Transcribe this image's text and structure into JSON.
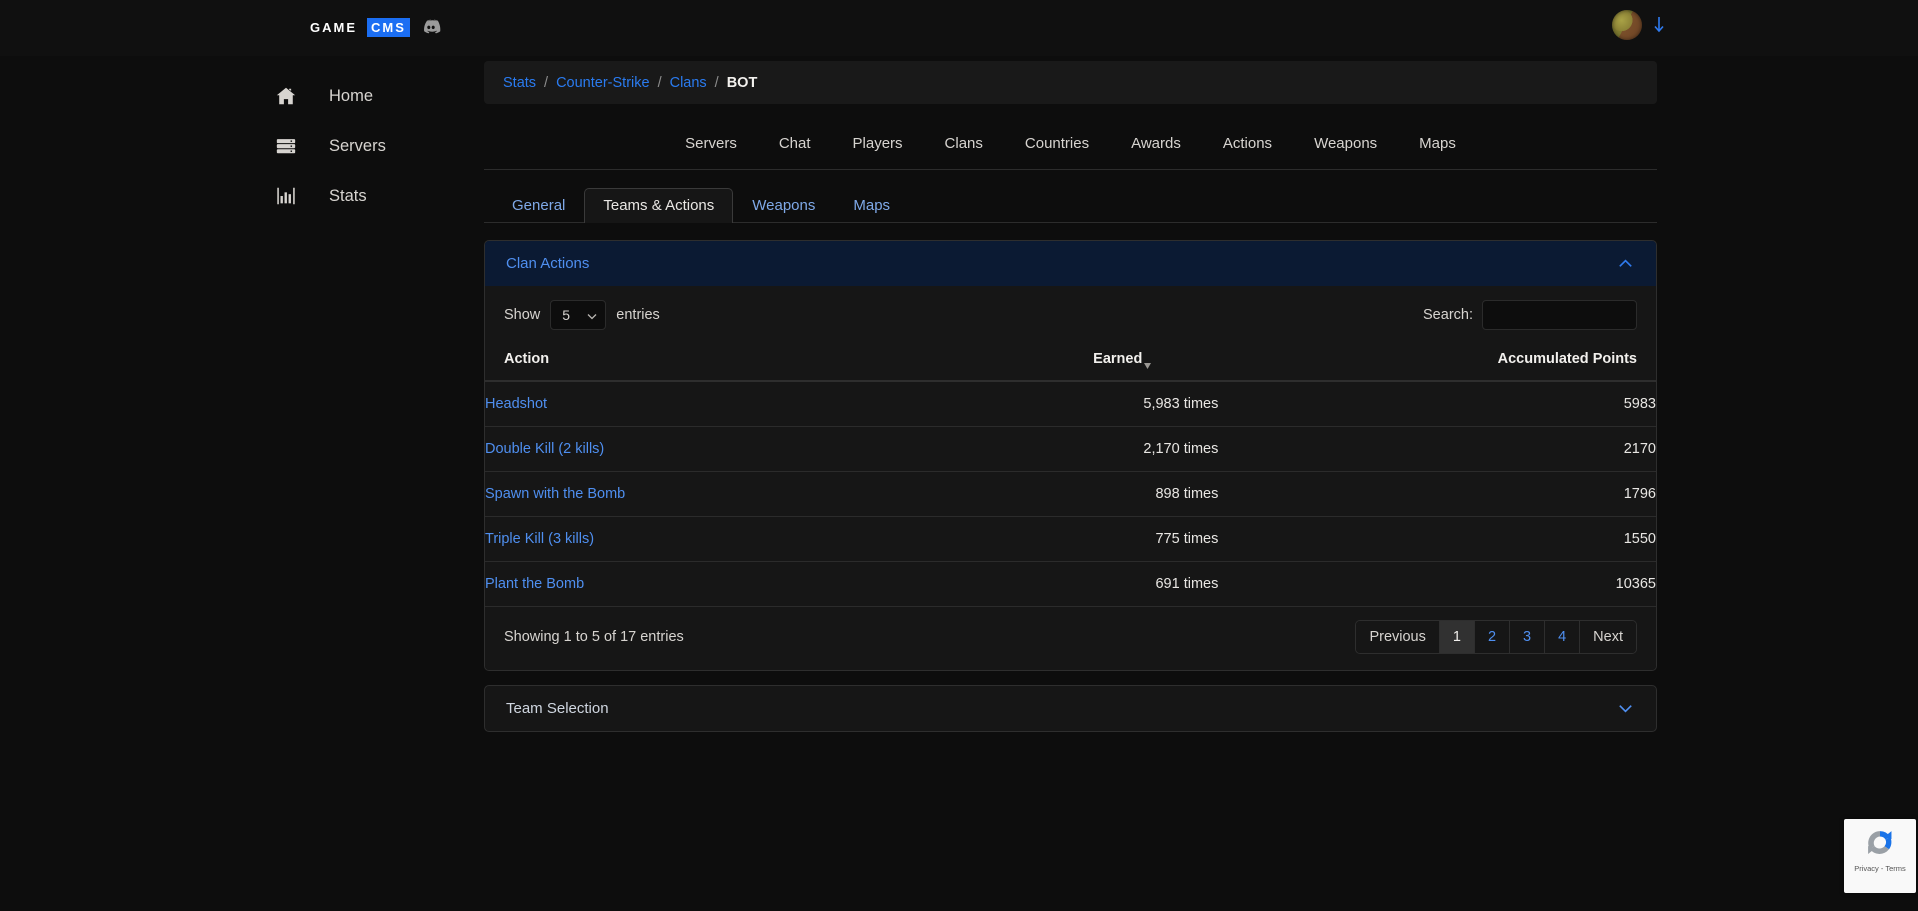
{
  "topbar": {
    "brand_first": "GAME",
    "brand_second": "CMS",
    "discord_icon": "discord-icon",
    "avatar_icon": "user-avatar",
    "dropdown_icon": "arrow-down-icon"
  },
  "sidebar": {
    "items": [
      {
        "label": "Home",
        "icon": "home-icon"
      },
      {
        "label": "Servers",
        "icon": "server-icon"
      },
      {
        "label": "Stats",
        "icon": "bar-chart-icon"
      }
    ]
  },
  "breadcrumb": {
    "items": [
      {
        "label": "Stats",
        "current": false
      },
      {
        "label": "Counter-Strike",
        "current": false
      },
      {
        "label": "Clans",
        "current": false
      },
      {
        "label": "BOT",
        "current": true
      }
    ],
    "separator": "/"
  },
  "mainnav": {
    "items": [
      "Servers",
      "Chat",
      "Players",
      "Clans",
      "Countries",
      "Awards",
      "Actions",
      "Weapons",
      "Maps"
    ]
  },
  "tabs": {
    "items": [
      "General",
      "Teams & Actions",
      "Weapons",
      "Maps"
    ],
    "active": "Teams & Actions"
  },
  "clan_actions": {
    "title": "Clan Actions",
    "collapse_icon": "chevron-up-icon",
    "length_label_before": "Show",
    "length_value": "5",
    "length_label_after": "entries",
    "search_label": "Search:",
    "search_value": "",
    "search_placeholder": "",
    "columns": [
      "Action",
      "Earned",
      "Accumulated Points"
    ],
    "sort_column": "Earned",
    "sort_direction": "desc",
    "rows": [
      {
        "action": "Headshot",
        "earned": "5,983 times",
        "points": "5983"
      },
      {
        "action": "Double Kill (2 kills)",
        "earned": "2,170 times",
        "points": "2170"
      },
      {
        "action": "Spawn with the Bomb",
        "earned": "898 times",
        "points": "1796"
      },
      {
        "action": "Triple Kill (3 kills)",
        "earned": "775 times",
        "points": "1550"
      },
      {
        "action": "Plant the Bomb",
        "earned": "691 times",
        "points": "10365"
      }
    ],
    "info": "Showing 1 to 5 of 17 entries",
    "pagination": {
      "previous": "Previous",
      "pages": [
        "1",
        "2",
        "3",
        "4"
      ],
      "active_page": "1",
      "next": "Next"
    }
  },
  "team_selection": {
    "title": "Team Selection",
    "collapse_icon": "chevron-down-icon"
  },
  "recaptcha": {
    "text": "Privacy - Terms",
    "icon": "recaptcha-icon"
  },
  "colors": {
    "accent_blue": "#4f8ff0",
    "brand_blue": "#1b6ef3",
    "panel_header_navy": "#0b1a33",
    "background": "#0d0d0d",
    "panel": "#161616"
  }
}
